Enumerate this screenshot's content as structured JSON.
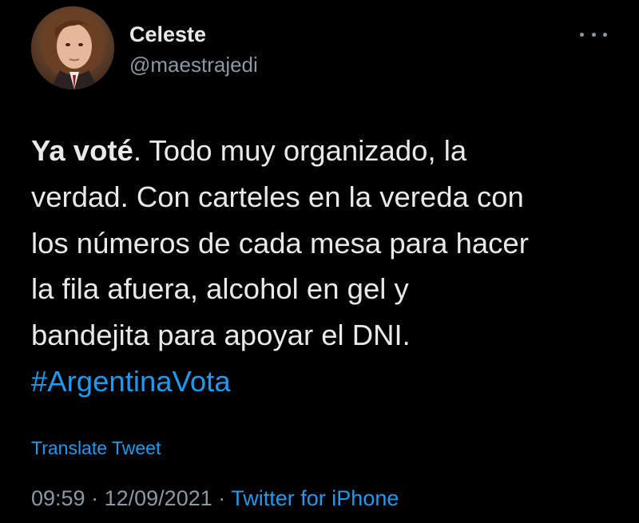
{
  "author": {
    "name": "Celeste",
    "handle": "@maestrajedi"
  },
  "tweet": {
    "lines": [
      {
        "bold": "Ya voté",
        "rest": ". Todo muy organizado, la"
      },
      {
        "text": "verdad. Con carteles en la vereda con"
      },
      {
        "text": "los números de cada mesa para hacer"
      },
      {
        "text": "la fila afuera, alcohol en gel y"
      },
      {
        "text": "bandejita para apoyar el DNI."
      }
    ],
    "hashtag": "#ArgentinaVota"
  },
  "translate_label": "Translate Tweet",
  "meta": {
    "time": "09:59",
    "separator": "·",
    "date": "12/09/2021",
    "source": "Twitter for iPhone"
  },
  "icons": {
    "more": "more-horizontal-icon"
  },
  "colors": {
    "background": "#000000",
    "text": "#e7e9ea",
    "secondary": "#8b98a5",
    "link": "#1d9bf0"
  }
}
